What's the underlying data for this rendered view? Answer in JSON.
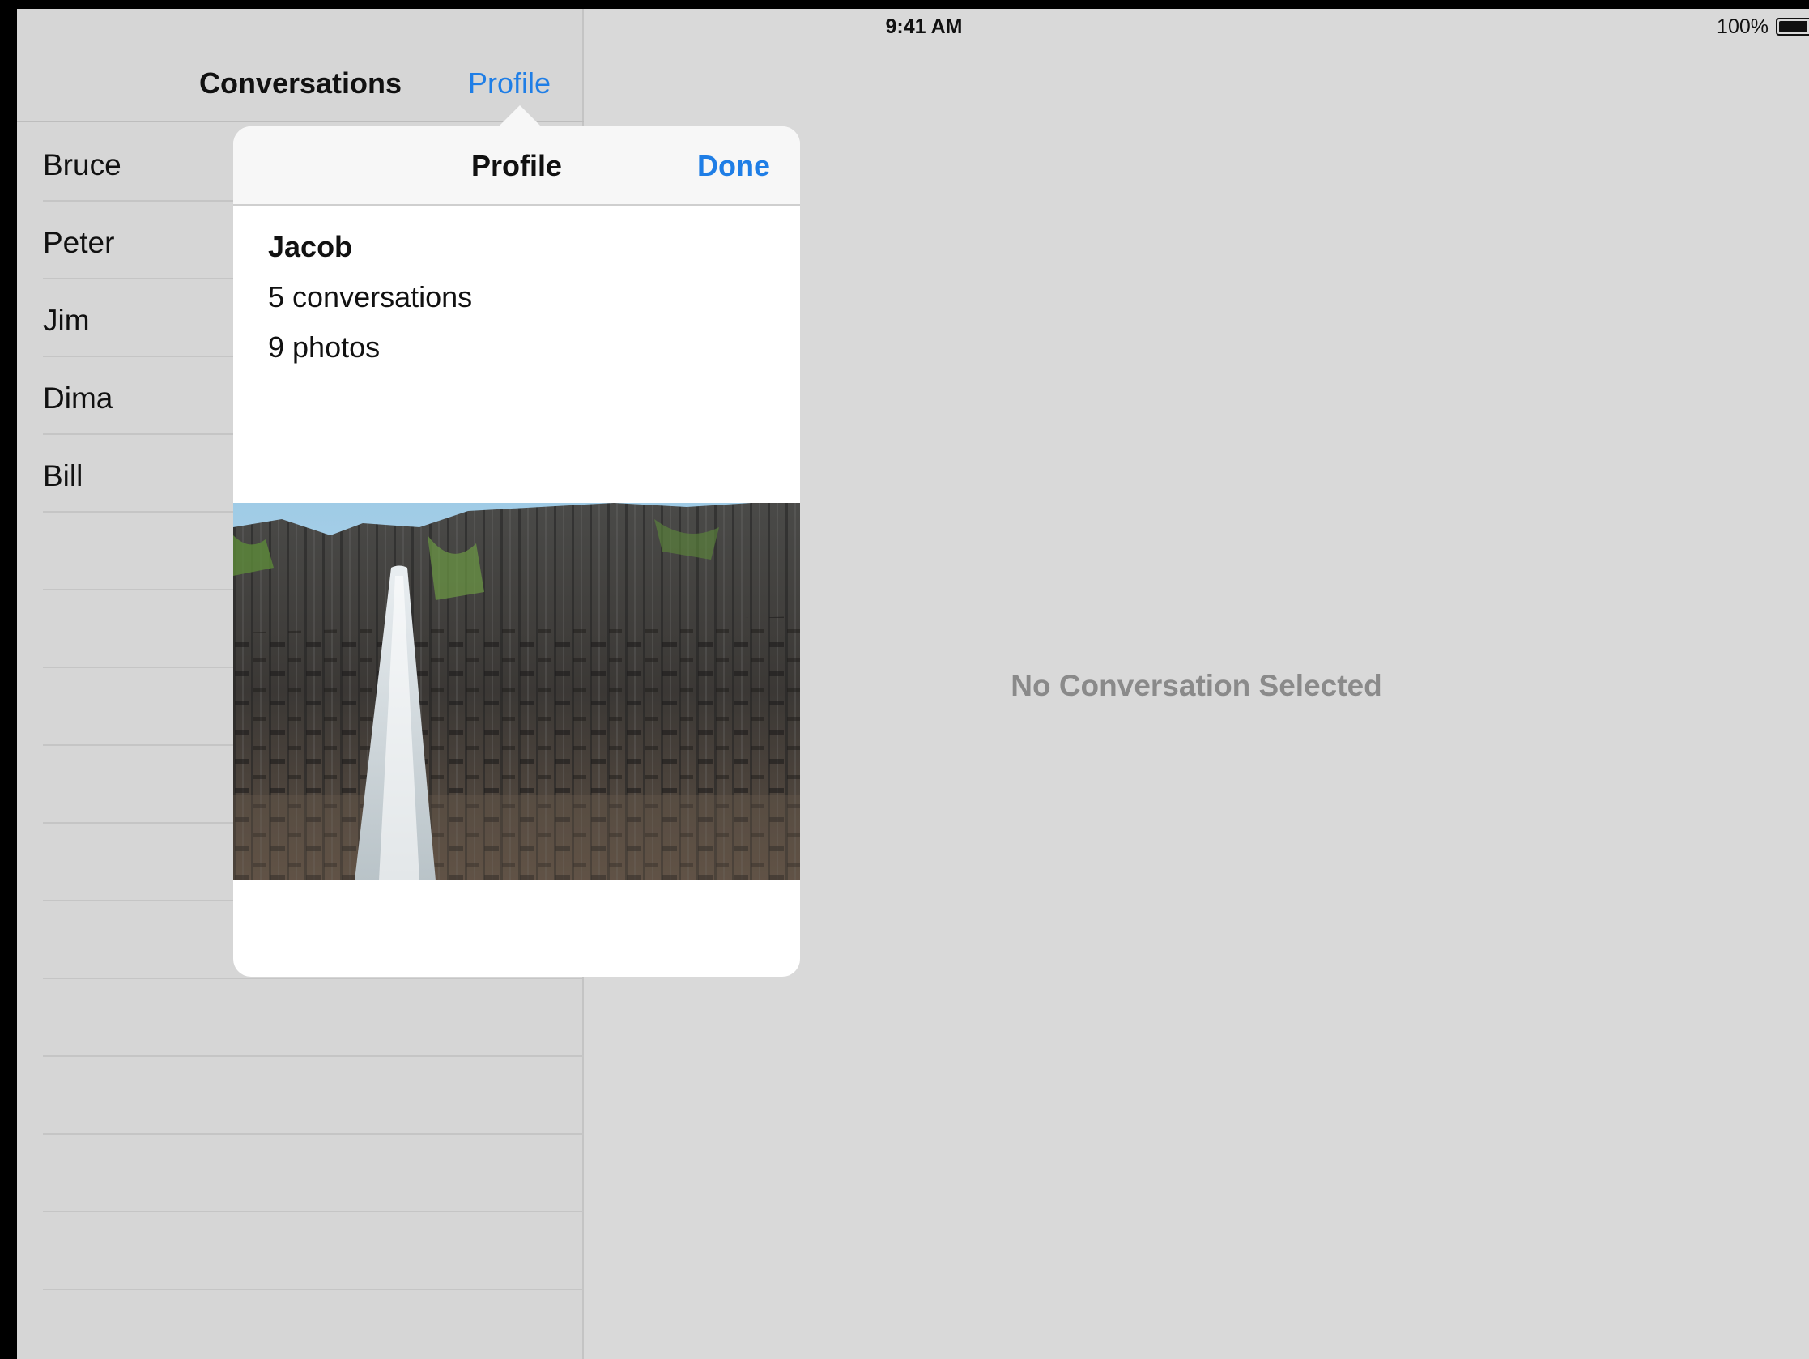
{
  "status_bar": {
    "device": "iPad",
    "time": "9:41 AM",
    "battery": "100%",
    "battery_level": 1.0
  },
  "master": {
    "title": "Conversations",
    "profile_button": "Profile",
    "conversations": [
      "Bruce",
      "Peter",
      "Jim",
      "Dima",
      "Bill",
      "",
      "",
      "",
      "",
      "",
      "",
      "",
      "",
      "",
      "",
      ""
    ]
  },
  "detail": {
    "empty_text": "No Conversation Selected"
  },
  "popover": {
    "title": "Profile",
    "done_label": "Done",
    "user_name": "Jacob",
    "conversations_count": "5 conversations",
    "photos_count": "9 photos",
    "photo_subject": "waterfall over basalt columns"
  },
  "colors": {
    "accent": "#1f7ee6",
    "background": "#d9d9d9",
    "secondary_text": "#8a8a8a"
  }
}
